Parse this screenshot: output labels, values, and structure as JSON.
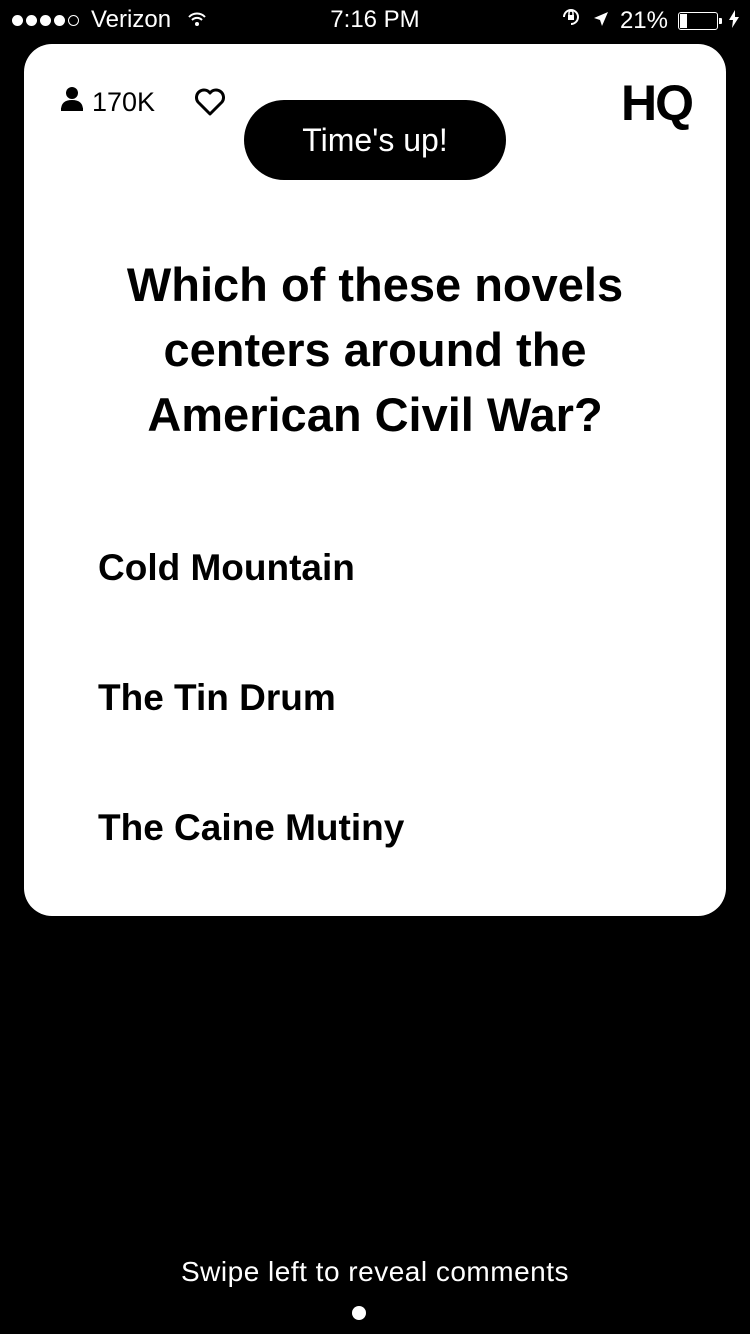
{
  "status_bar": {
    "signal_filled": 4,
    "signal_total": 5,
    "carrier": "Verizon",
    "time": "7:16 PM",
    "battery_percent": "21%",
    "battery_level": 0.21
  },
  "card": {
    "viewer_count": "170K",
    "timer_label": "Time's up!",
    "logo": "HQ",
    "question": "Which of these novels centers around the American Civil War?",
    "answers": [
      "Cold Mountain",
      "The Tin Drum",
      "The Caine Mutiny"
    ]
  },
  "footer": {
    "swipe_hint": "Swipe left to reveal comments"
  },
  "colors": {
    "background": "#000000",
    "card": "#ffffff",
    "text_primary": "#000000",
    "text_inverse": "#ffffff"
  },
  "icons": [
    "user-icon",
    "heart-icon",
    "wifi-icon",
    "rotation-lock-icon",
    "location-arrow-icon",
    "battery-icon",
    "charging-bolt-icon"
  ]
}
